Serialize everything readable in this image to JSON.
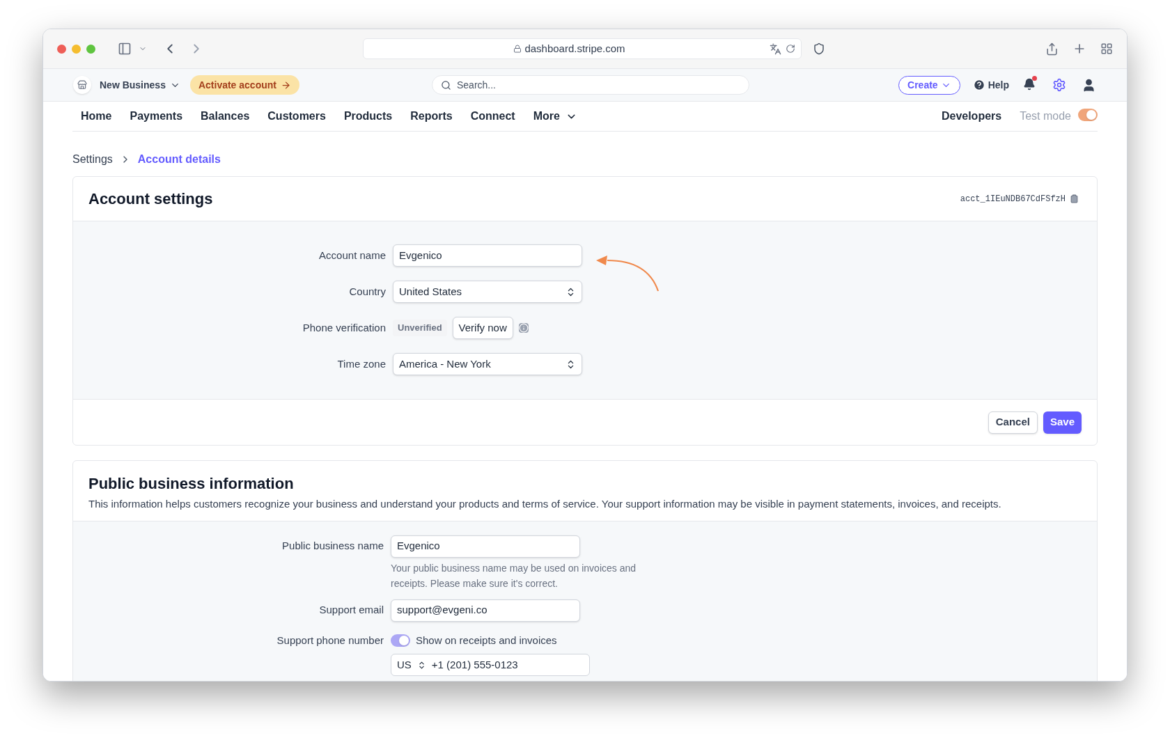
{
  "browser": {
    "url": "dashboard.stripe.com"
  },
  "header": {
    "business": "New Business",
    "activate": "Activate account",
    "search_placeholder": "Search...",
    "create": "Create",
    "help": "Help",
    "notification_dot": true
  },
  "nav": {
    "items": [
      {
        "label": "Home"
      },
      {
        "label": "Payments"
      },
      {
        "label": "Balances"
      },
      {
        "label": "Customers"
      },
      {
        "label": "Products"
      },
      {
        "label": "Reports"
      },
      {
        "label": "Connect"
      },
      {
        "label": "More",
        "kind": "menu"
      }
    ],
    "developers": "Developers",
    "test_mode": {
      "label": "Test mode",
      "on": true
    }
  },
  "breadcrumb": [
    {
      "label": "Settings",
      "selected": false
    },
    {
      "label": "Account details",
      "selected": true
    }
  ],
  "account_settings": {
    "title": "Account settings",
    "account_id": "acct_1IEuNDB67CdFSfzH",
    "fields": [
      {
        "label": "Account name",
        "kind": "text",
        "value": "Evgenico"
      },
      {
        "label": "Country",
        "kind": "select",
        "value": "United States"
      },
      {
        "label": "Phone verification",
        "kind": "verify",
        "status": "Unverified",
        "button": "Verify now"
      },
      {
        "label": "Time zone",
        "kind": "select",
        "value": "America - New York"
      }
    ],
    "buttons": [
      "Cancel",
      "Save"
    ]
  },
  "public_info": {
    "title": "Public business information",
    "description": "This information helps customers recognize your business and understand your products and terms of service. Your support information may be visible in payment statements, invoices, and receipts.",
    "fields": [
      {
        "label": "Public business name",
        "kind": "text",
        "value": "Evgenico",
        "help": "Your public business name may be used on invoices and receipts. Please make sure it's correct."
      },
      {
        "label": "Support email",
        "kind": "text",
        "value": "support@evgeni.co"
      },
      {
        "label": "Support phone number",
        "kind": "phone",
        "toggle_label": "Show on receipts and invoices",
        "on": true,
        "country": "US",
        "phone": "+1 (201) 555-0123"
      }
    ]
  }
}
